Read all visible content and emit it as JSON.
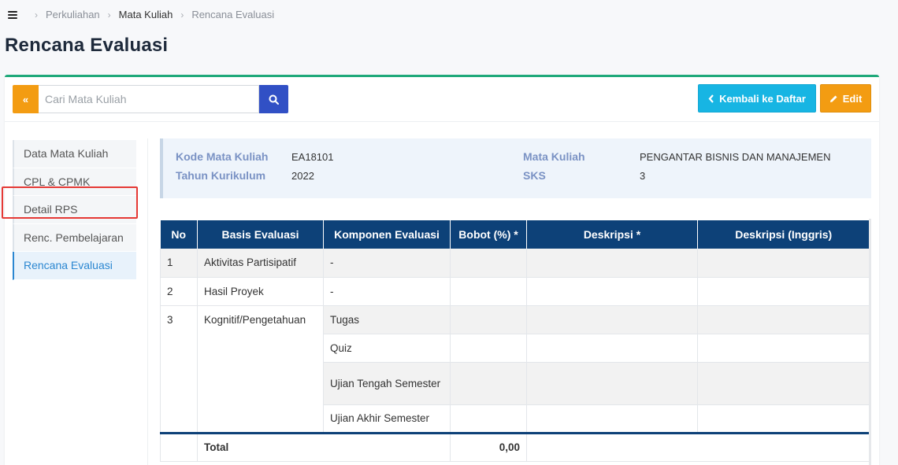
{
  "breadcrumb": {
    "items": [
      "Perkuliahan",
      "Mata Kuliah",
      "Rencana Evaluasi"
    ]
  },
  "page_title": "Rencana Evaluasi",
  "toolbar": {
    "search_placeholder": "Cari Mata Kuliah",
    "search_value": "",
    "back_label": "Kembali ke Daftar",
    "edit_label": "Edit",
    "collapse_glyph": "«"
  },
  "sidenav": {
    "items": [
      "Data Mata Kuliah",
      "CPL & CPMK",
      "Detail RPS",
      "Renc. Pembelajaran",
      "Rencana Evaluasi"
    ],
    "active": "Rencana Evaluasi"
  },
  "info": {
    "kode_label": "Kode Mata Kuliah",
    "kode_value": "EA18101",
    "tahun_label": "Tahun Kurikulum",
    "tahun_value": "2022",
    "matkul_label": "Mata Kuliah",
    "matkul_value": "PENGANTAR BISNIS DAN MANAJEMEN",
    "sks_label": "SKS",
    "sks_value": "3"
  },
  "table": {
    "headers": [
      "No",
      "Basis Evaluasi",
      "Komponen Evaluasi",
      "Bobot (%) *",
      "Deskripsi *",
      "Deskripsi (Inggris)"
    ],
    "rows": [
      {
        "no": "1",
        "basis": "Aktivitas Partisipatif",
        "komponen": "-"
      },
      {
        "no": "2",
        "basis": "Hasil Proyek",
        "komponen": "-"
      },
      {
        "no": "3",
        "basis": "Kognitif/Pengetahuan",
        "komponen": [
          "Tugas",
          "Quiz",
          "Ujian Tengah Semester",
          "Ujian Akhir Semester"
        ]
      }
    ],
    "total_label": "Total",
    "total_value": "0,00"
  },
  "colors": {
    "accent_green": "#1fa97a",
    "header_navy": "#0d4178",
    "btn_orange": "#f39c12",
    "btn_cyan": "#17b5e3",
    "btn_blue": "#3150c5",
    "highlight_red": "#e53935"
  },
  "icons": [
    "menu-icon",
    "chevron-right-icon",
    "double-chevron-left-icon",
    "search-icon",
    "chevron-left-icon",
    "pencil-icon"
  ]
}
